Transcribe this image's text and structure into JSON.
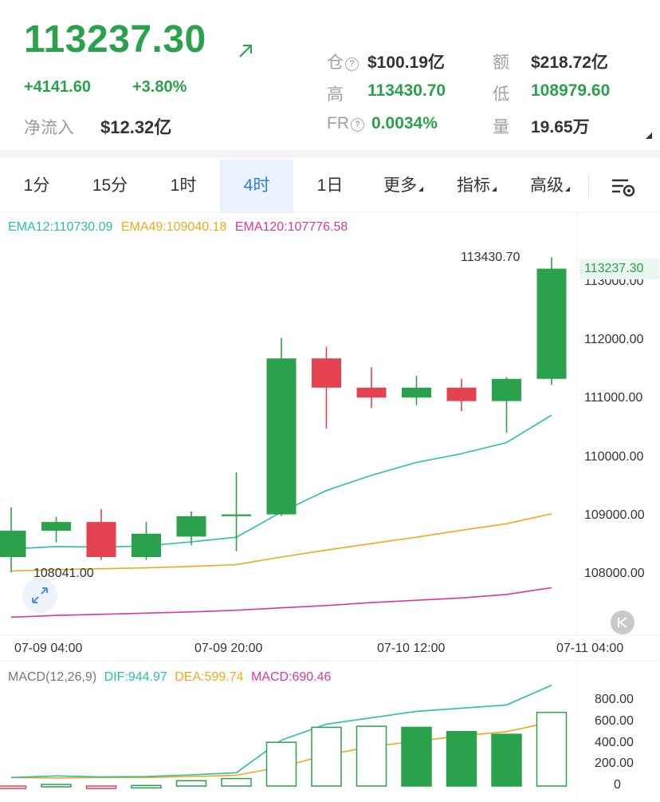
{
  "header": {
    "price": "113237.30",
    "change": "+4141.60",
    "change_pct": "+3.80%",
    "net_inflow_label": "净流入",
    "net_inflow_value": "$12.32亿",
    "stats": {
      "oi_label": "仓",
      "oi_value": "$100.19亿",
      "amount_label": "额",
      "amount_value": "$218.72亿",
      "high_label": "高",
      "high_value": "113430.70",
      "low_label": "低",
      "low_value": "108979.60",
      "fr_label": "FR",
      "fr_value": "0.0034%",
      "vol_label": "量",
      "vol_value": "19.65万"
    }
  },
  "tabs": [
    {
      "label": "1分",
      "active": false
    },
    {
      "label": "15分",
      "active": false
    },
    {
      "label": "1时",
      "active": false
    },
    {
      "label": "4时",
      "active": true
    },
    {
      "label": "1日",
      "active": false
    },
    {
      "label": "更多",
      "active": false
    },
    {
      "label": "指标",
      "active": false
    },
    {
      "label": "高级",
      "active": false
    }
  ],
  "ema": {
    "ema12": "EMA12:110730.09",
    "ema49": "EMA49:109040.18",
    "ema120": "EMA120:107776.58"
  },
  "macd": {
    "label": "MACD(12,26,9)",
    "dif": "DIF:944.97",
    "dea": "DEA:599.74",
    "macd": "MACD:690.46"
  },
  "colors": {
    "up": "#2aa14b",
    "down": "#e5424f",
    "ema12": "#2bbfa4",
    "ema49": "#f0a81c",
    "ema120": "#d9399a",
    "active_tab": "#2f7be6"
  },
  "chart_data": [
    {
      "type": "candlestick",
      "interval": "4时",
      "y_axis_ticks": [
        "113000.00",
        "112000.00",
        "111000.00",
        "110000.00",
        "109000.00",
        "108000.00"
      ],
      "ylim": [
        107200,
        113800
      ],
      "x_tick_labels": [
        "07-09 04:00",
        "07-09 20:00",
        "07-10 12:00",
        "07-11 04:00"
      ],
      "current_price_tag": "113237.30",
      "high_marker": "113430.70",
      "low_marker": "108041.00",
      "candles": [
        {
          "open": 108300,
          "close": 108750,
          "high": 109150,
          "low": 108041
        },
        {
          "open": 108750,
          "close": 108900,
          "high": 108990,
          "low": 108550
        },
        {
          "open": 108900,
          "close": 108300,
          "high": 109120,
          "low": 108250
        },
        {
          "open": 108300,
          "close": 108700,
          "high": 108900,
          "low": 108250
        },
        {
          "open": 108650,
          "close": 109000,
          "high": 109080,
          "low": 108500
        },
        {
          "open": 109000,
          "close": 109030,
          "high": 109750,
          "low": 108400
        },
        {
          "open": 109030,
          "close": 111700,
          "high": 112050,
          "low": 109000
        },
        {
          "open": 111700,
          "close": 111200,
          "high": 111900,
          "low": 110500
        },
        {
          "open": 111200,
          "close": 111030,
          "high": 111550,
          "low": 110850
        },
        {
          "open": 111030,
          "close": 111200,
          "high": 111400,
          "low": 110900
        },
        {
          "open": 111200,
          "close": 110970,
          "high": 111350,
          "low": 110800
        },
        {
          "open": 110970,
          "close": 111350,
          "high": 111380,
          "low": 110430
        },
        {
          "open": 111350,
          "close": 113237.3,
          "high": 113430.7,
          "low": 111250
        }
      ],
      "ema12": [
        108440,
        108480,
        108470,
        108490,
        108560,
        108640,
        109070,
        109440,
        109700,
        109920,
        110070,
        110260,
        110730.09
      ],
      "ema49": [
        108060,
        108085,
        108100,
        108115,
        108140,
        108170,
        108300,
        108420,
        108530,
        108640,
        108760,
        108870,
        109040.18
      ],
      "ema120": [
        107270,
        107300,
        107320,
        107340,
        107360,
        107390,
        107430,
        107470,
        107520,
        107560,
        107600,
        107660,
        107776.58
      ]
    },
    {
      "type": "macd",
      "y_axis_ticks": [
        "800.00",
        "600.00",
        "400.00",
        "200.00",
        "0"
      ],
      "ylim": [
        -30,
        940
      ],
      "macd": [
        -20,
        15,
        -15,
        5,
        50,
        70,
        410,
        550,
        560,
        550,
        510,
        485,
        690.46
      ],
      "dif": [
        80,
        95,
        85,
        90,
        105,
        125,
        430,
        580,
        640,
        700,
        730,
        760,
        944.97
      ],
      "dea": [
        80,
        75,
        80,
        80,
        90,
        100,
        180,
        290,
        370,
        420,
        470,
        510,
        599.74
      ]
    }
  ]
}
